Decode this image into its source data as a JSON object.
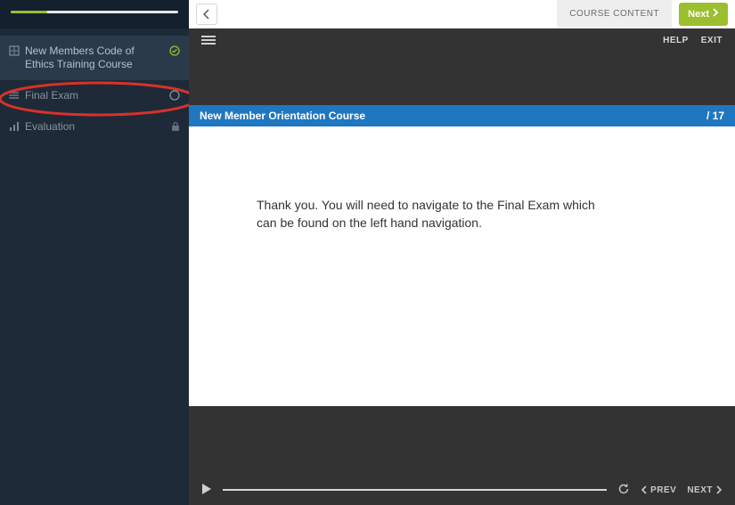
{
  "sidebar": {
    "progress_pct": 22,
    "items": [
      {
        "label": "New Members Code of Ethics Training Course",
        "status": "complete"
      },
      {
        "label": "Final Exam",
        "status": "ring"
      },
      {
        "label": "Evaluation",
        "status": "locked"
      }
    ]
  },
  "topbar": {
    "course_content_label": "COURSE CONTENT",
    "next_label": "Next"
  },
  "player": {
    "help_label": "HELP",
    "exit_label": "EXIT",
    "title": "New Member Orientation Course",
    "page_indicator": "/ 17",
    "body_text": "Thank you. You will need to navigate to the Final Exam which can be found on the left hand navigation.",
    "prev_label": "PREV",
    "next_label": "NEXT"
  },
  "colors": {
    "accent_green": "#9bbf2e",
    "title_blue": "#1f77c0",
    "highlight_red": "#d8322a"
  }
}
